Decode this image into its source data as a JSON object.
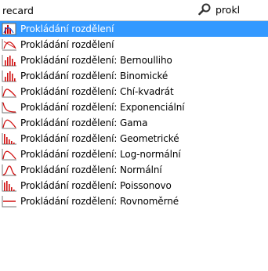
{
  "header": {
    "query_text": "recard",
    "search_label": "prokl"
  },
  "items": [
    {
      "label": "Prokládání rozdělení",
      "icon": "distribution-fit-icon",
      "selected": true
    },
    {
      "label": "Prokládání rozdělení",
      "icon": "scatter-curve-icon",
      "selected": false
    },
    {
      "label": "Prokládání rozdělení: Bernoulliho",
      "icon": "bernoulli-bars-icon",
      "selected": false
    },
    {
      "label": "Prokládání rozdělení: Binomické",
      "icon": "binomial-bars-icon",
      "selected": false
    },
    {
      "label": "Prokládání rozdělení: Chí-kvadrát",
      "icon": "chi-square-curve-icon",
      "selected": false
    },
    {
      "label": "Prokládání rozdělení: Exponenciální",
      "icon": "exponential-curve-icon",
      "selected": false
    },
    {
      "label": "Prokládání rozdělení: Gama",
      "icon": "gamma-curve-icon",
      "selected": false
    },
    {
      "label": "Prokládání rozdělení: Geometrické",
      "icon": "geometric-bars-icon",
      "selected": false
    },
    {
      "label": "Prokládání rozdělení: Log-normální",
      "icon": "lognormal-curve-icon",
      "selected": false
    },
    {
      "label": "Prokládání rozdělení: Normální",
      "icon": "normal-curve-icon",
      "selected": false
    },
    {
      "label": "Prokládání rozdělení: Poissonovo",
      "icon": "poisson-bars-icon",
      "selected": false
    },
    {
      "label": "Prokládání rozdělení: Rovnoměrné",
      "icon": "uniform-line-icon",
      "selected": false
    }
  ],
  "colors": {
    "selection": "#3399ff",
    "icon_red": "#d01010",
    "icon_frame": "#7a7a7a"
  }
}
